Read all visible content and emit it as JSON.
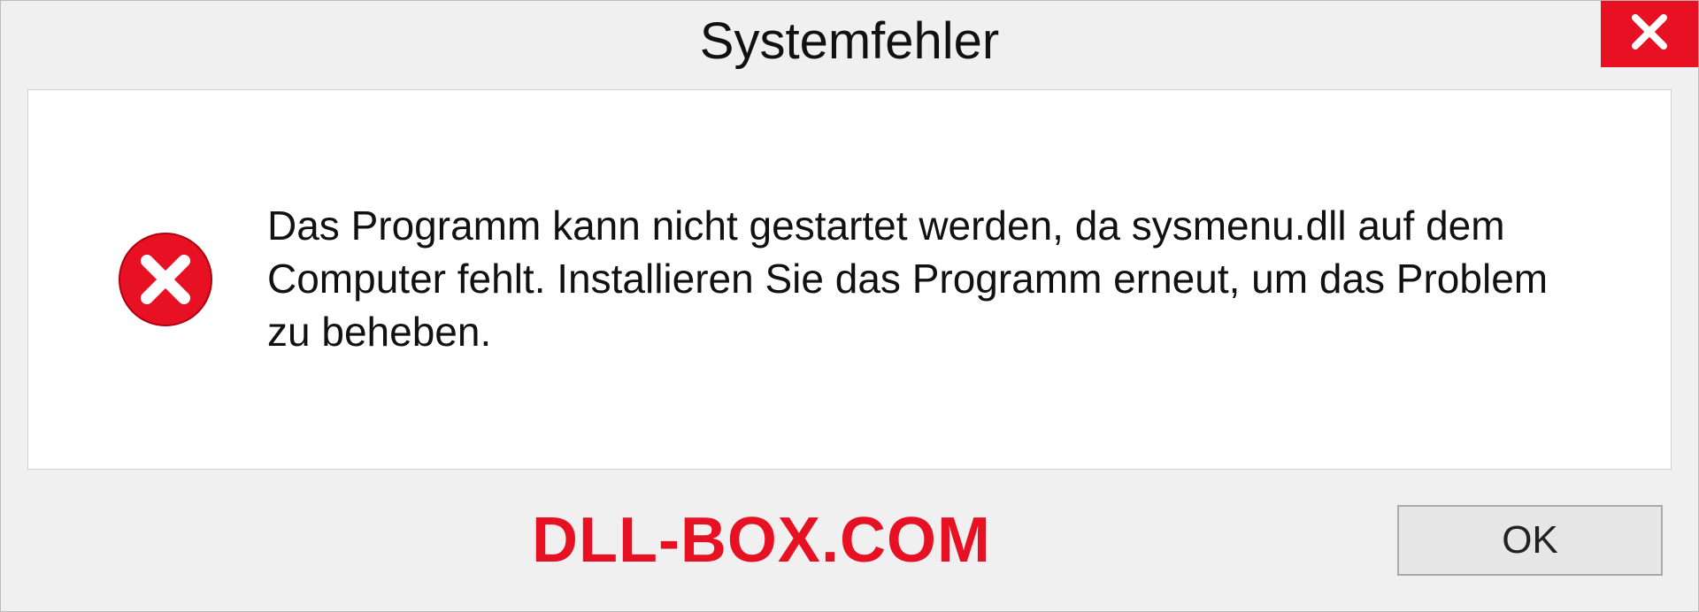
{
  "dialog": {
    "title": "Systemfehler",
    "message": "Das Programm kann nicht gestartet werden, da sysmenu.dll auf dem Computer fehlt. Installieren Sie das Programm erneut, um das Problem zu beheben.",
    "ok_label": "OK"
  },
  "watermark": {
    "text": "DLL-BOX.COM"
  },
  "colors": {
    "accent_red": "#e81123",
    "bg_chrome": "#f0f0f0",
    "bg_content": "#ffffff"
  }
}
